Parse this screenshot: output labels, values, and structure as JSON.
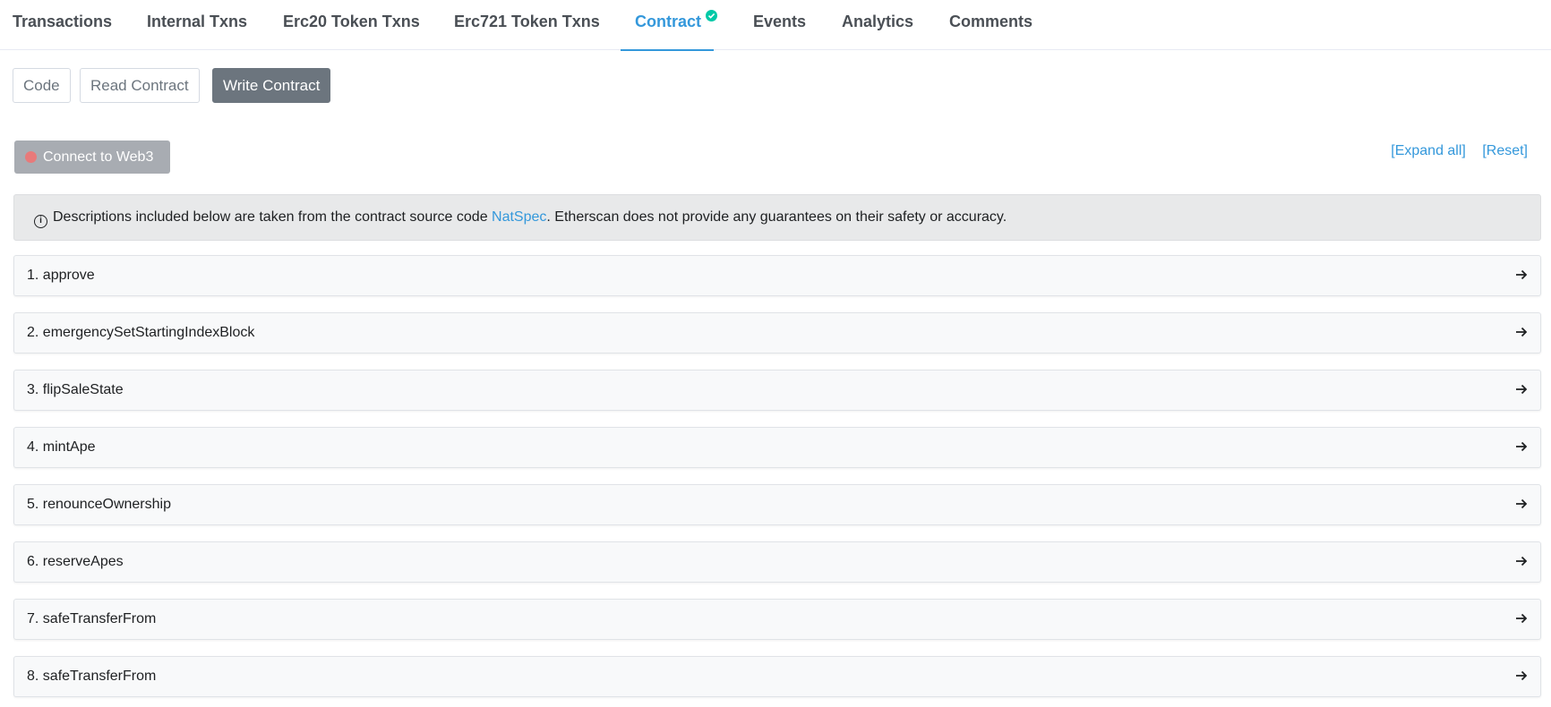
{
  "tabs": [
    {
      "label": "Transactions"
    },
    {
      "label": "Internal Txns"
    },
    {
      "label": "Erc20 Token Txns"
    },
    {
      "label": "Erc721 Token Txns"
    },
    {
      "label": "Contract",
      "active": true,
      "icon": "verified-check-icon"
    },
    {
      "label": "Events"
    },
    {
      "label": "Analytics"
    },
    {
      "label": "Comments"
    }
  ],
  "subtabs": [
    {
      "label": "Code"
    },
    {
      "label": "Read Contract"
    },
    {
      "label": "Write Contract",
      "active": true
    }
  ],
  "connect": {
    "label": "Connect to Web3",
    "status_color": "#e87a7a"
  },
  "links": {
    "expand_all": "[Expand all]",
    "reset": "[Reset]"
  },
  "notice": {
    "before": "Descriptions included below are taken from the contract source code ",
    "link": "NatSpec",
    "after": ". Etherscan does not provide any guarantees on their safety or accuracy."
  },
  "functions": [
    {
      "label": "1. approve"
    },
    {
      "label": "2. emergencySetStartingIndexBlock"
    },
    {
      "label": "3. flipSaleState"
    },
    {
      "label": "4. mintApe"
    },
    {
      "label": "5. renounceOwnership"
    },
    {
      "label": "6. reserveApes"
    },
    {
      "label": "7. safeTransferFrom"
    },
    {
      "label": "8. safeTransferFrom"
    }
  ],
  "colors": {
    "accent": "#3498db",
    "active_subtab": "#6c757e",
    "verified": "#00c9a7"
  }
}
